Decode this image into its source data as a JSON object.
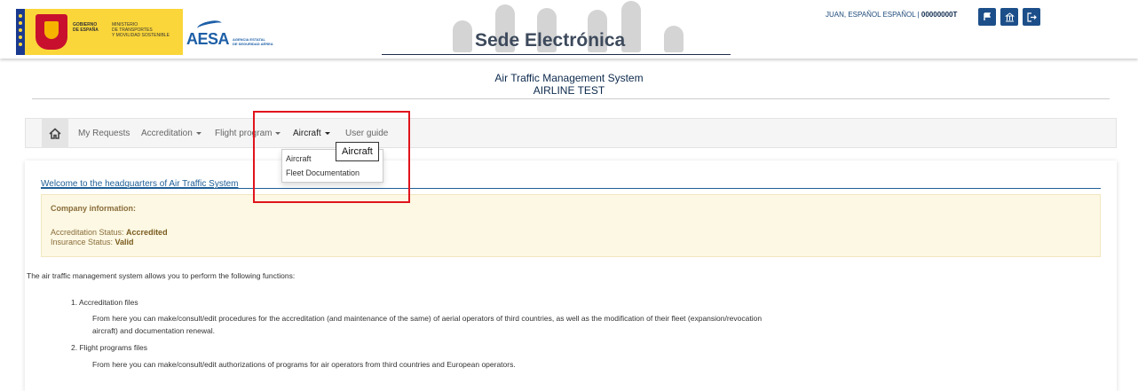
{
  "header": {
    "gov_text": [
      "GOBIERNO",
      "DE ESPAÑA"
    ],
    "ministry_text": [
      "MINISTERIO",
      "DE TRANSPORTES",
      "Y MOVILIDAD SOSTENIBLE"
    ],
    "aesa_word": "AESA",
    "aesa_sub": [
      "AGENCIA ESTATAL",
      "DE SEGURIDAD AÉREA"
    ],
    "sede_title": "Sede Electrónica",
    "user_name": "JUAN, ESPAÑOL ESPAÑOL | ",
    "user_id": "00000000T",
    "buttons": [
      "flag-icon",
      "building-icon",
      "logout-icon"
    ]
  },
  "system": {
    "title": "Air Traffic Management System",
    "subtitle": "AIRLINE TEST"
  },
  "nav": {
    "home_icon": "home-icon",
    "items": [
      {
        "label": "My Requests",
        "dropdown": false
      },
      {
        "label": "Accreditation",
        "dropdown": true
      },
      {
        "label": "Flight program",
        "dropdown": true
      },
      {
        "label": "Aircraft",
        "dropdown": true
      },
      {
        "label": "User guide",
        "dropdown": false
      }
    ],
    "dropdown_items": [
      "Aircraft",
      "Fleet Documentation"
    ],
    "tooltip": "Aircraft"
  },
  "main": {
    "welcome": "Welcome to the headquarters of Air Traffic System",
    "company_info_title": "Company information:",
    "accreditation_label": "Accreditation Status: ",
    "accreditation_value": "Accredited",
    "insurance_label": "Insurance Status: ",
    "insurance_value": "Valid",
    "intro": "The air traffic management system allows you to perform the following functions:",
    "functions": [
      {
        "title": "1. Accreditation files",
        "desc_line1": "From here you can make/consult/edit procedures for the accreditation (and maintenance of the same) of aerial operators of third countries, as well as the modification of their fleet (expansion/revocation",
        "desc_line2": "aircraft) and documentation renewal."
      },
      {
        "title": "2. Flight programs files",
        "desc_line1": "From here you can make/consult/edit authorizations of programs for air operators from third countries and European operators."
      }
    ]
  },
  "colors": {
    "accent": "#1c4f8a",
    "link": "#1e5e96",
    "alert_bg": "#fcf8e3",
    "alert_text": "#8a6d3b",
    "highlight": "#e0141c"
  }
}
